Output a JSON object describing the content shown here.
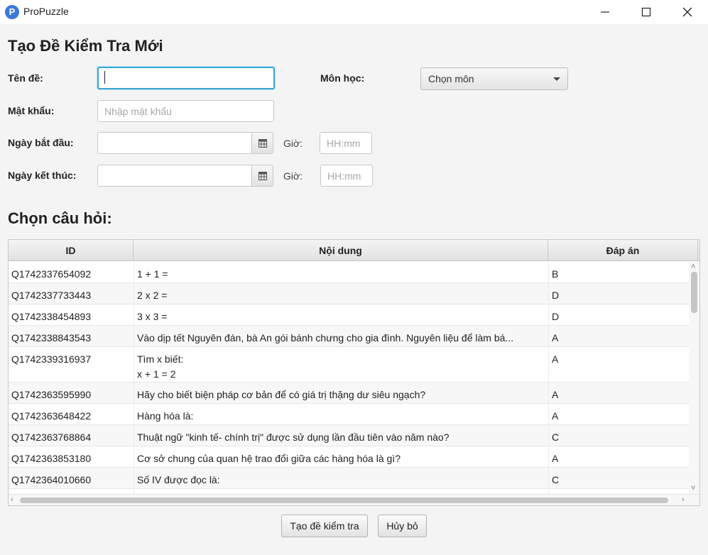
{
  "window": {
    "app_logo": "P",
    "title": "ProPuzzle",
    "icons": [
      "minimize-icon",
      "maximize-icon",
      "close-icon"
    ]
  },
  "form": {
    "page_title": "Tạo Đề Kiểm Tra Mới",
    "name_label": "Tên đề:",
    "name_value": "",
    "subject_label": "Môn học:",
    "subject_value": "Chọn môn",
    "password_label": "Mật khẩu:",
    "password_placeholder": "Nhập mật khẩu",
    "start_date_label": "Ngày bắt đầu:",
    "start_time_label": "Giờ:",
    "start_time_placeholder": "HH:mm",
    "end_date_label": "Ngày kết thúc:",
    "end_time_label": "Giờ:",
    "end_time_placeholder": "HH:mm"
  },
  "questions": {
    "section_title": "Chọn câu hỏi:",
    "columns": [
      "ID",
      "Nội dung",
      "Đáp án"
    ],
    "rows": [
      {
        "id": "Q1742337654092",
        "content": "1 + 1 =",
        "answer": "B"
      },
      {
        "id": "Q1742337733443",
        "content": "2 x 2 =",
        "answer": "D"
      },
      {
        "id": "Q1742338454893",
        "content": "3 x 3 =",
        "answer": "D"
      },
      {
        "id": "Q1742338843543",
        "content": "Vào dịp tết Nguyên đán, bà An gói bánh chưng cho gia đình. Nguyên liệu để làm bá...",
        "answer": "A"
      },
      {
        "id": "Q1742339316937",
        "content": "Tìm x biết:\nx + 1 = 2",
        "answer": "A"
      },
      {
        "id": "Q1742363595990",
        "content": "Hãy cho biết biện pháp cơ bản để có giá trị thặng dư siêu ngạch?",
        "answer": "A"
      },
      {
        "id": "Q1742363648422",
        "content": "Hàng hóa là:",
        "answer": "A"
      },
      {
        "id": "Q1742363768864",
        "content": "Thuật ngữ \"kinh tế- chính trị\" được sử dụng lần đầu tiên vào năm nào?",
        "answer": "C"
      },
      {
        "id": "Q1742363853180",
        "content": "Cơ sở chung của quan hệ trao đổi giữa các hàng hóa là gì?",
        "answer": "A"
      },
      {
        "id": "Q1742364010660",
        "content": "Số IV được đọc là:",
        "answer": "C"
      }
    ]
  },
  "actions": {
    "create_label": "Tạo đề kiểm tra",
    "cancel_label": "Hủy bỏ"
  }
}
